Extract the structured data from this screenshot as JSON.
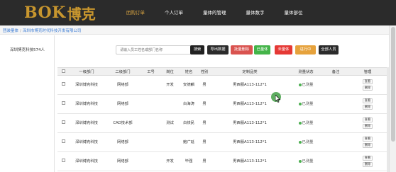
{
  "header": {
    "logo_text": "BOK",
    "logo_cn": "博克",
    "nav": [
      {
        "label": "团购订单",
        "active": true
      },
      {
        "label": "个人订单",
        "active": false
      },
      {
        "label": "量体的管理",
        "active": false
      },
      {
        "label": "量体数字",
        "active": false
      },
      {
        "label": "量体部位",
        "active": false
      }
    ]
  },
  "breadcrumb": {
    "root": "团装量体",
    "separator": "/",
    "current": "深圳市博克时代科技开发有限公司"
  },
  "left_panel": {
    "company": "深圳博克科技574人"
  },
  "toolbar": {
    "search_placeholder": "请输入员工姓名或部门名称",
    "search_btn": "搜索",
    "export_btn": "导出数据",
    "delete_btn": "批量删除",
    "measured_btn": "已量体",
    "unmeasured_btn": "未量体",
    "progress_btn": "进行中",
    "all_btn": "全部人员"
  },
  "table": {
    "headers": [
      "一级部门",
      "二级部门",
      "工号",
      "岗位",
      "姓名",
      "性别",
      "定制品类",
      "测量状态",
      "备注",
      "管理"
    ],
    "rows": [
      {
        "dept1": "深圳博克科技",
        "dept2": "网络部",
        "id": "",
        "post": "开发",
        "name": "安德麟",
        "gender": "男",
        "category": "男西服A113-112*1",
        "status": "已测量",
        "note": ""
      },
      {
        "dept1": "深圳博克科技",
        "dept2": "网络部",
        "id": "",
        "post": "",
        "name": "白海涛",
        "gender": "男",
        "category": "男西服A113-112*1",
        "status": "已测量",
        "note": ""
      },
      {
        "dept1": "深圳博克科技",
        "dept2": "CAD技术部",
        "id": "",
        "post": "测试",
        "name": "白铁民",
        "gender": "男",
        "category": "男西服A113-112*1",
        "status": "已测量",
        "note": ""
      },
      {
        "dept1": "深圳博克科技",
        "dept2": "网络部",
        "id": "",
        "post": "",
        "name": "鲍广廷",
        "gender": "男",
        "category": "男西服A113-112*1",
        "status": "已测量",
        "note": ""
      },
      {
        "dept1": "深圳博克科技",
        "dept2": "网络部",
        "id": "",
        "post": "开发",
        "name": "毕强",
        "gender": "男",
        "category": "男西服A113-112*1",
        "status": "已测量",
        "note": ""
      }
    ],
    "view_label": "查看",
    "delete_label": "删除"
  },
  "colors": {
    "header_bg": "#2b2b2b",
    "brand_gold": "#c8962e",
    "status_green": "#4caf50"
  }
}
